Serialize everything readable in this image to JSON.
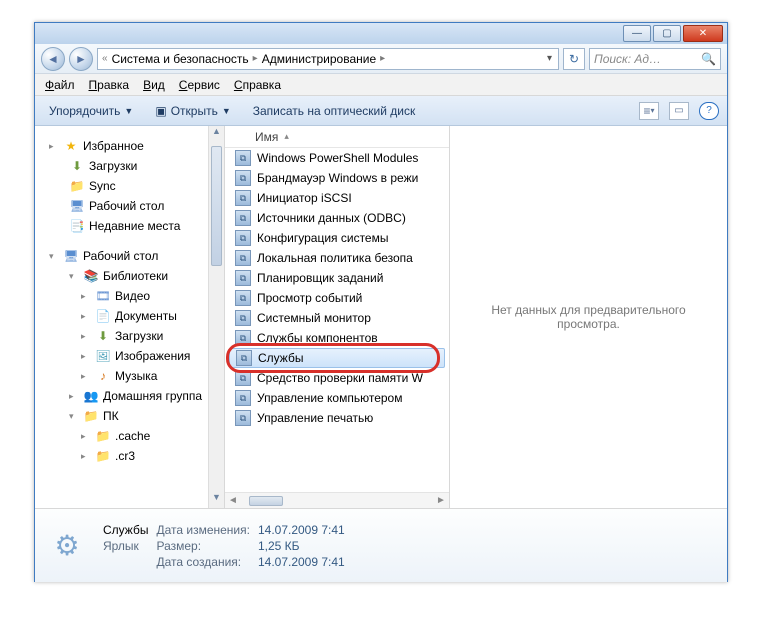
{
  "titlebar": {
    "min": "—",
    "max": "▢",
    "close": "✕"
  },
  "nav": {
    "back": "◄",
    "forward": "►",
    "prefix": "«",
    "seg1": "Система и безопасность",
    "seg2": "Администрирование",
    "dd": "▾",
    "refresh": "↻",
    "search_placeholder": "Поиск: Ад…",
    "search_icon": "🔍"
  },
  "menu": {
    "file": "Файл",
    "edit": "Правка",
    "view": "Вид",
    "tools": "Сервис",
    "help": "Справка"
  },
  "toolbar": {
    "organize": "Упорядочить",
    "open_icon": "▣",
    "open": "Открыть",
    "burn": "Записать на оптический диск",
    "viewmode_icon": "≡",
    "pane_icon": "▭",
    "help_icon": "?"
  },
  "tree": {
    "favorites": "Избранное",
    "downloads": "Загрузки",
    "sync": "Sync",
    "desktop": "Рабочий стол",
    "recent": "Недавние места",
    "desktop_root": "Рабочий стол",
    "libraries": "Библиотеки",
    "video": "Видео",
    "documents": "Документы",
    "downloads2": "Загрузки",
    "pictures": "Изображения",
    "music": "Музыка",
    "homegroup": "Домашняя группа",
    "pc": "ПК",
    "cache": ".cache",
    "cr3": ".cr3"
  },
  "column": {
    "name": "Имя"
  },
  "files": [
    "Windows PowerShell Modules",
    "Брандмауэр Windows в режи",
    "Инициатор iSCSI",
    "Источники данных (ODBC)",
    "Конфигурация системы",
    "Локальная политика безопа",
    "Планировщик заданий",
    "Просмотр событий",
    "Системный монитор",
    "Службы компонентов",
    "Службы",
    "Средство проверки памяти W",
    "Управление компьютером",
    "Управление печатью"
  ],
  "selected_index": 10,
  "preview": "Нет данных для предварительного просмотра.",
  "details": {
    "name": "Службы",
    "type": "Ярлык",
    "mod_label": "Дата изменения:",
    "mod_value": "14.07.2009 7:41",
    "size_label": "Размер:",
    "size_value": "1,25 КБ",
    "created_label": "Дата создания:",
    "created_value": "14.07.2009 7:41"
  }
}
